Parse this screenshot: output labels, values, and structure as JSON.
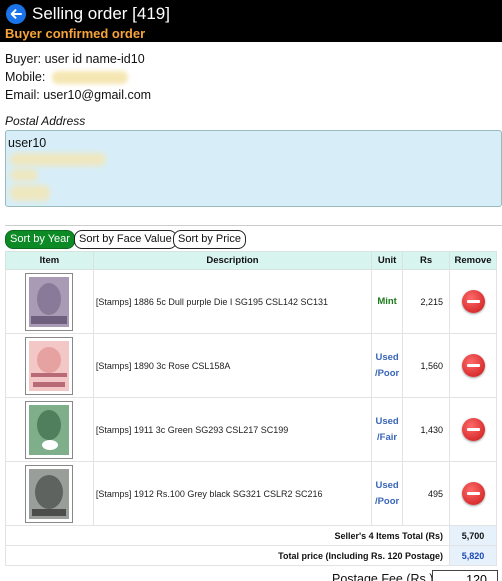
{
  "header": {
    "title": "Selling order [419]",
    "status": "Buyer confirmed order"
  },
  "buyer": {
    "buyer_text": "Buyer: user id name-id10",
    "mobile_label": "Mobile:",
    "email_text": "Email: user10@gmail.com"
  },
  "postal": {
    "label": "Postal Address",
    "line1": "user10"
  },
  "sort_buttons": [
    "Sort by Year",
    "Sort by Face Value",
    "Sort by Price"
  ],
  "table": {
    "headers": [
      "Item",
      "Description",
      "Unit",
      "Rs",
      "Remove"
    ],
    "rows": [
      {
        "description": "[Stamps] 1886 5c Dull purple Die I SG195 CSL142 SC131",
        "unit": "Mint",
        "rs": "2,215"
      },
      {
        "description": "[Stamps] 1890 3c Rose CSL158A",
        "unit": "Used /Poor",
        "rs": "1,560"
      },
      {
        "description": "[Stamps] 1911 3c Green SG293 CSL217 SC199",
        "unit": "Used /Fair",
        "rs": "1,430"
      },
      {
        "description": "[Stamps] 1912 Rs.100 Grey black SG321 CSLR2 SC216",
        "unit": "Used /Poor",
        "rs": "495"
      }
    ],
    "seller_total_label": "Seller's 4 Items Total (Rs)",
    "seller_total_value": "5,700",
    "grand_total_label": "Total price (Including Rs. 120 Postage)",
    "grand_total_value": "5,820"
  },
  "postage": {
    "label": "Postage Fee (Rs.)",
    "value": "120"
  },
  "colors": {
    "header_bg": "#000000",
    "status_orange": "#f7a43a",
    "active_sort_green": "#0c8a26",
    "mint_green": "#1d7a1d",
    "used_blue": "#3a66b8",
    "remove_red": "#c81616"
  },
  "icons": {
    "back": "back-arrow-icon",
    "remove": "remove-minus-icon"
  }
}
